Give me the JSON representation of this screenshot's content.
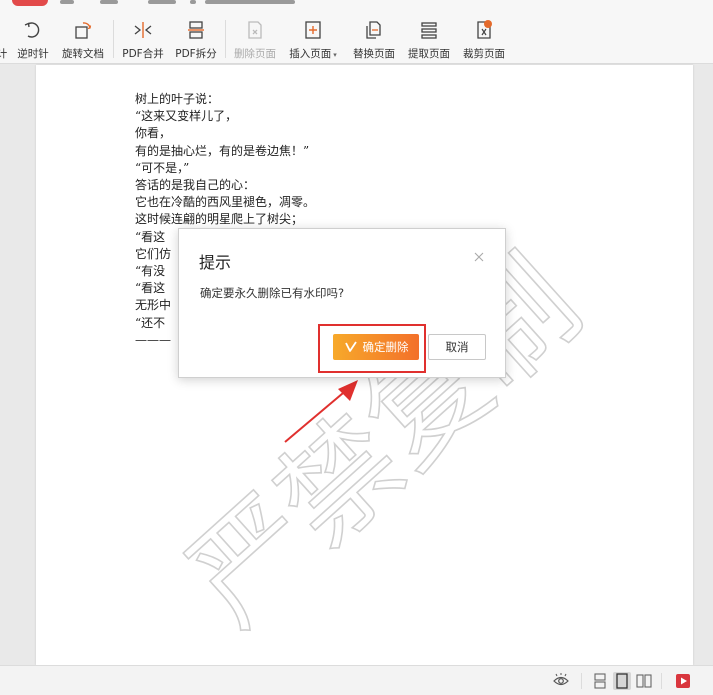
{
  "toolbar": {
    "items": [
      {
        "label": "计",
        "icon": "rotate-clockwise-icon"
      },
      {
        "label": "逆时针",
        "icon": "rotate-counterclockwise-icon"
      },
      {
        "label": "旋转文档",
        "icon": "rotate-document-icon"
      },
      {
        "label": "PDF合并",
        "icon": "pdf-merge-icon"
      },
      {
        "label": "PDF拆分",
        "icon": "pdf-split-icon"
      },
      {
        "label": "删除页面",
        "icon": "delete-page-icon",
        "disabled": true
      },
      {
        "label": "插入页面",
        "icon": "insert-page-icon"
      },
      {
        "label": "替换页面",
        "icon": "replace-page-icon"
      },
      {
        "label": "提取页面",
        "icon": "extract-page-icon"
      },
      {
        "label": "裁剪页面",
        "icon": "crop-page-icon"
      }
    ],
    "caret": "▾"
  },
  "document": {
    "lines": [
      "树上的叶子说：",
      "“这来又变样儿了，",
      "你看，",
      "有的是抽心烂，有的是卷边焦！”",
      "“可不是，”",
      "答话的是我自己的心：",
      "它也在冷酷的西风里褪色，凋零。",
      "这时候连翩的明星爬上了树尖；",
      "“看这",
      "它们仿",
      "“有没",
      "“看这",
      "无形中",
      "“还不",
      "———"
    ],
    "watermark": "严禁复制"
  },
  "dialog": {
    "title": "提示",
    "message": "确定要永久删除已有水印吗?",
    "confirm_label": "确定删除",
    "cancel_label": "取消",
    "close_symbol": "×"
  },
  "colors": {
    "highlight": "#e0302e",
    "confirm_start": "#f7a92a",
    "confirm_end": "#f3702a",
    "arrow": "#e0302e",
    "watermark": "#c8c8c8"
  },
  "statusbar": {
    "icons": [
      "eye-icon",
      "continuous-view-icon",
      "single-page-view-icon",
      "two-page-view-icon",
      "play-icon"
    ]
  }
}
